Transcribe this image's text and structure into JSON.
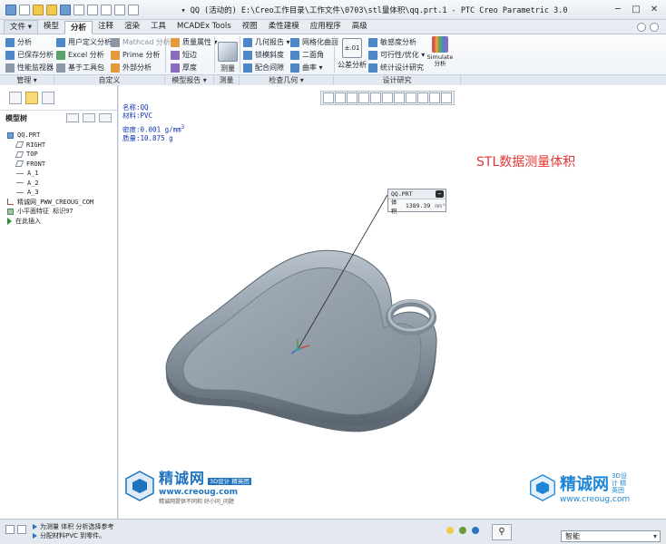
{
  "titlebar": {
    "title": "▾ QQ (活动的) E:\\Creo工作目录\\工作文件\\0703\\stl量体积\\qq.prt.1 - PTC Creo Parametric 3.0"
  },
  "menu_tabs": [
    "文件 ▾",
    "模型",
    "分析",
    "注释",
    "渲染",
    "工具",
    "MCADEx Tools",
    "视图",
    "柔性建模",
    "应用程序",
    "高级"
  ],
  "active_tab_index": 2,
  "ribbon": {
    "col1": [
      "分析",
      "已保存分析",
      "性能监视器"
    ],
    "col2": [
      "用户定义分析",
      "Excel 分析",
      "基于工具包"
    ],
    "col3": [
      "Mathcad 分析",
      "Prime 分析",
      "外部分析"
    ],
    "col4": [
      "质量属性 ▾",
      "短边",
      "厚度"
    ],
    "measure_label": "测量",
    "col5": [
      "几何报告 ▾",
      "锁模斜度",
      "配合间隙"
    ],
    "col6": [
      "网格化曲面",
      "二面角",
      "曲率 ▾"
    ],
    "tolerance_label": "公差分析",
    "col7": [
      "敏感度分析",
      "可行性/优化 ▾",
      "统计设计研究"
    ],
    "simulate_label": "Simulate 分析"
  },
  "groups": [
    "管理 ▾",
    "自定义",
    "模型报告 ▾",
    "测量",
    "检查几何 ▾",
    "设计研究"
  ],
  "left_panel": {
    "header": "模型树",
    "tree": [
      {
        "label": "QQ.PRT",
        "type": "part",
        "indent": 0
      },
      {
        "label": "RIGHT",
        "type": "plane",
        "indent": 1
      },
      {
        "label": "TOP",
        "type": "plane",
        "indent": 1
      },
      {
        "label": "FRONT",
        "type": "plane",
        "indent": 1
      },
      {
        "label": "A_1",
        "type": "axis",
        "indent": 1
      },
      {
        "label": "A_2",
        "type": "axis",
        "indent": 1
      },
      {
        "label": "A_3",
        "type": "axis",
        "indent": 1
      },
      {
        "label": "精诚网_PWW_CREOUG_COM",
        "type": "csys",
        "indent": 0
      },
      {
        "label": "小平面特征 标识97",
        "type": "feat",
        "indent": 0
      },
      {
        "label": "在此插入",
        "type": "ins",
        "indent": 0
      }
    ]
  },
  "model_info": {
    "name": "名称:QQ",
    "material": "材料:PVC",
    "density_prefix": "密度:0.001 g/mm",
    "density_exp": "3",
    "mass": "质量:10.875 g"
  },
  "annotation": "STL数据测量体积",
  "query_box": {
    "title": "QQ.PRT",
    "row_label": "体积",
    "row_value": "1389.39",
    "row_unit": "mm³"
  },
  "logo_center": {
    "name": "精诚网",
    "tag": "3D设计 精英团",
    "url": "www.creoug.com",
    "slogan": "精诚网提供不同和 好小问_问题"
  },
  "logo_right": {
    "name": "精诚网",
    "tag": "3D设计 精英团",
    "url": "www.creoug.com"
  },
  "statusbar": {
    "line1": "为测量 体积 分析选择参考",
    "line2": "分配材料PVC 到零件。",
    "filter_value": "智能"
  },
  "colors": {
    "accent_blue": "#1e73be",
    "annotation_red": "#e23434",
    "model_gray": "#8a97a3",
    "info_blue": "#1234b0"
  }
}
